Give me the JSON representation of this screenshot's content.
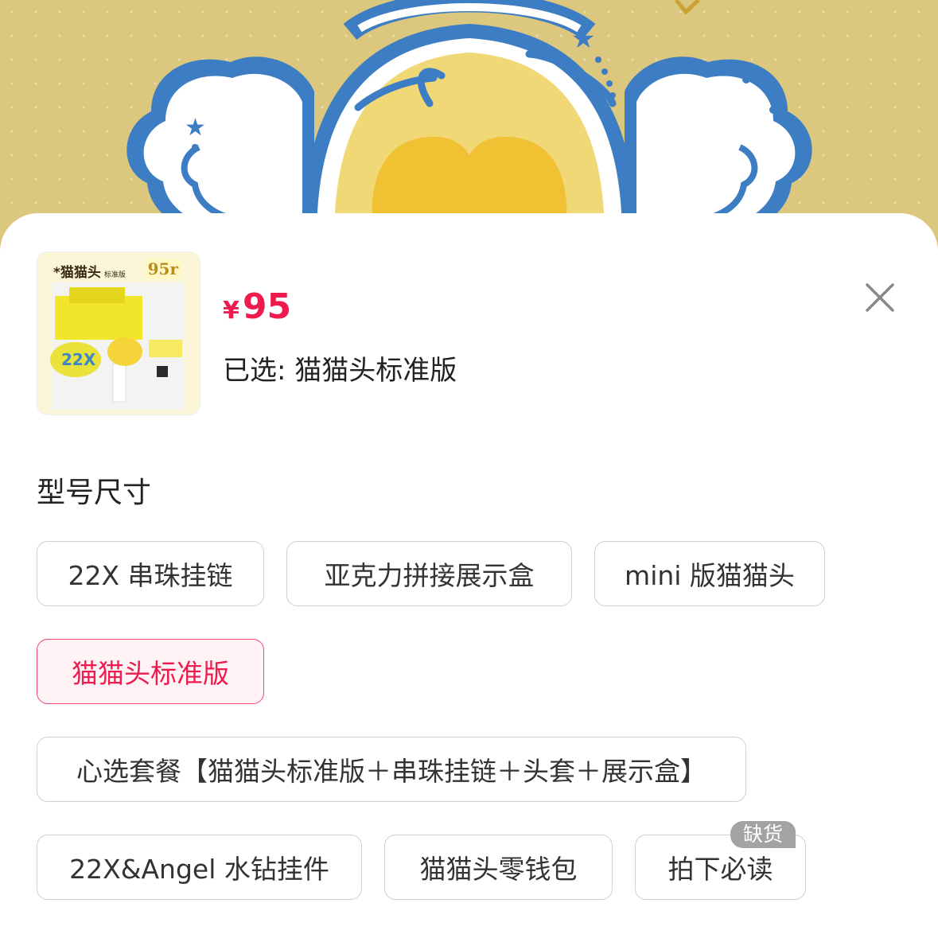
{
  "product": {
    "thumbnail_title": "*猫猫头",
    "thumbnail_subtitle": "标准版",
    "thumbnail_badge": "95r",
    "currency": "¥",
    "price": "95",
    "selected_text": "已选: 猫猫头标准版"
  },
  "section": {
    "title": "型号尺寸"
  },
  "options": [
    {
      "label": "22X 串珠挂链",
      "selected": false
    },
    {
      "label": "亚克力拼接展示盒",
      "selected": false
    },
    {
      "label": "mini 版猫猫头",
      "selected": false
    },
    {
      "label": "猫猫头标准版",
      "selected": true
    },
    {
      "label": "心选套餐【猫猫头标准版＋串珠挂链＋头套＋展示盒】",
      "selected": false
    },
    {
      "label": "22X&Angel 水钻挂件",
      "selected": false
    },
    {
      "label": "猫猫头零钱包",
      "selected": false
    },
    {
      "label": "拍下必读",
      "selected": false,
      "tag": "缺货"
    }
  ],
  "colors": {
    "accent": "#ee1b4e",
    "selected_bg": "#fff3f5",
    "border": "#cfcfcf",
    "tag_bg": "#a3a3a3",
    "art_blue": "#3d7dc4",
    "art_yellow": "#f5cf45"
  },
  "icons": {
    "close": "close-icon"
  }
}
